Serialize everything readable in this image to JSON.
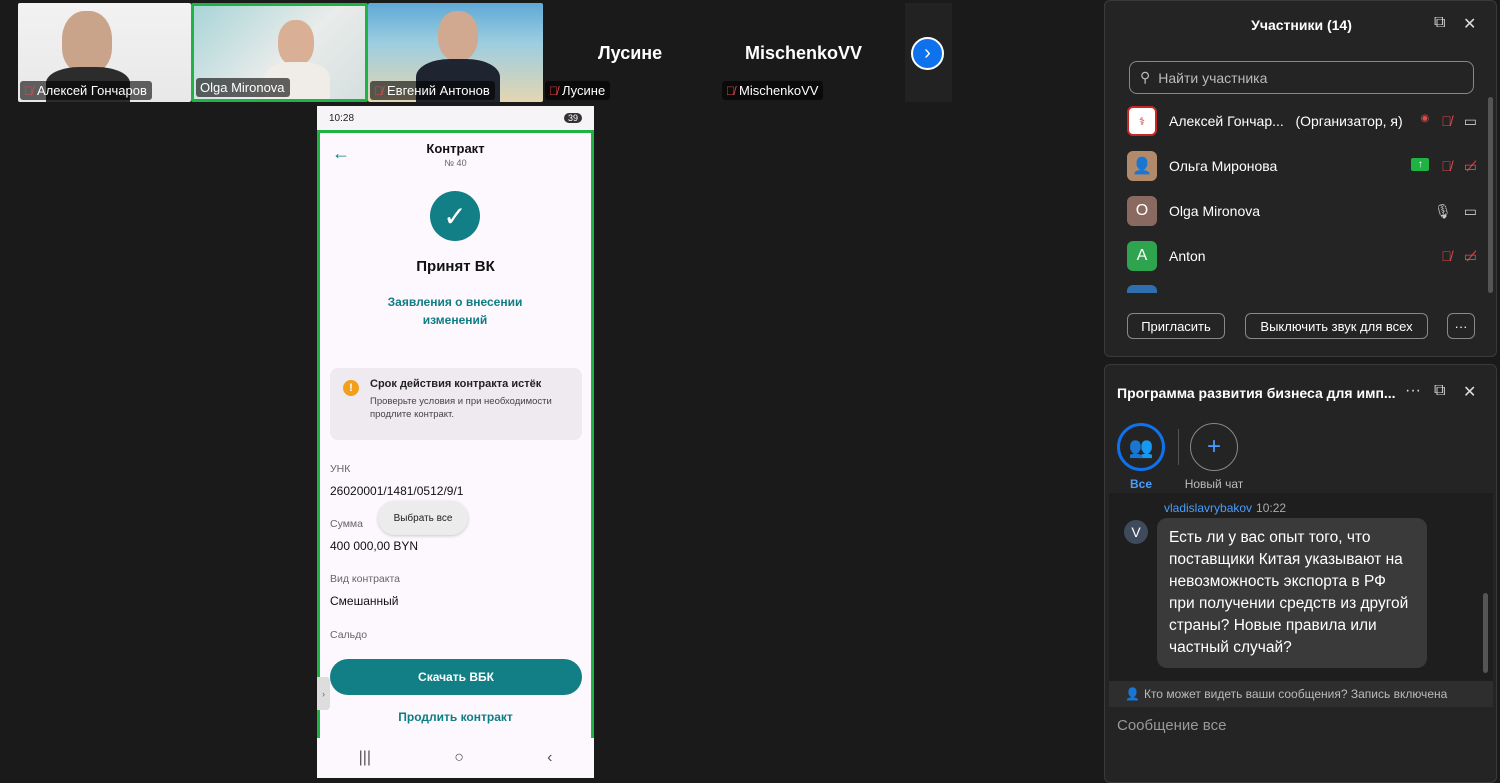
{
  "tiles": [
    {
      "name": "Алексей Гончаров"
    },
    {
      "name": "Olga Mironova"
    },
    {
      "name": "Евгений Антонов"
    },
    {
      "name": "Лусине"
    },
    {
      "name": "MischenkoVV"
    }
  ],
  "tile_headers": {
    "lusine": "Лусине",
    "mischenko": "MischenkoVV"
  },
  "phone": {
    "time": "10:28",
    "battery": "39",
    "title": "Контракт",
    "number": "№ 40",
    "status": "Принят ВК",
    "statement_link": "Заявления о внесении изменений",
    "warning_title": "Срок действия контракта истёк",
    "warning_text": "Проверьте условия и при необходимости продлите контракт.",
    "unk_label": "УНК",
    "unk_value": "26020001/1481/0512/9/1",
    "sum_label": "Сумма",
    "sum_value": "400 000,00 BYN",
    "select_all": "Выбрать все",
    "type_label": "Вид контракта",
    "type_value": "Смешанный",
    "saldo_label": "Сальдо",
    "download_button": "Скачать ВБК",
    "extend_link": "Продлить контракт"
  },
  "participants": {
    "title": "Участники (14)",
    "search_placeholder": "Найти участника",
    "list": [
      {
        "name": "Алексей Гончар...",
        "role": "(Организатор, я)"
      },
      {
        "name": "Ольга Миронова"
      },
      {
        "name": "Olga Mironova",
        "initial": "O"
      },
      {
        "name": "Anton",
        "initial": "A"
      }
    ],
    "invite_button": "Пригласить",
    "mute_all_button": "Выключить звук для всех",
    "more_button": "···"
  },
  "chat": {
    "title": "Программа развития бизнеса для имп...",
    "all_label": "Все",
    "new_chat_label": "Новый чат",
    "message": {
      "sender": "vladislavrybakov",
      "time": "10:22",
      "avatar_initial": "V",
      "text": "Есть ли у вас опыт того, что поставщики Китая указывают на невозможность экспорта в РФ при получении средств из другой страны? Новые правила или частный случай?"
    },
    "privacy_note": "Кто может видеть ваши сообщения? Запись включена",
    "compose_placeholder": "Сообщение все"
  },
  "colors": {
    "accent": "#0e72ed",
    "teal": "#127f87",
    "active_border": "#1fb344",
    "mute_red": "#e5484d"
  }
}
